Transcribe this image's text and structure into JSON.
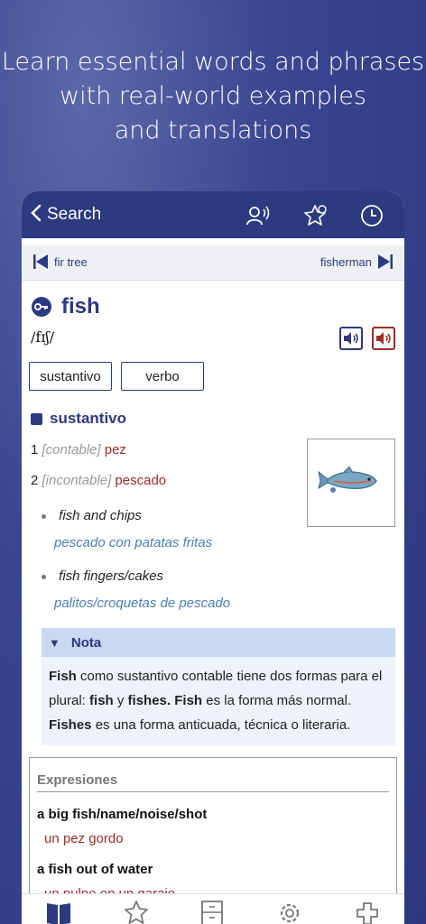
{
  "promo": {
    "line1": "Learn essential words and phrases",
    "line2": "with real-world examples",
    "line3": "and translations"
  },
  "topbar": {
    "back_label": "Search"
  },
  "nav": {
    "prev": "fir tree",
    "next": "fisherman"
  },
  "entry": {
    "headword": "fish",
    "pronunciation": "/fɪʃ/",
    "pos_buttons": [
      "sustantivo",
      "verbo"
    ],
    "section_title": "sustantivo",
    "senses": [
      {
        "num": "1",
        "label": "[contable]",
        "translation": "pez"
      },
      {
        "num": "2",
        "label": "[incontable]",
        "translation": "pescado"
      }
    ],
    "examples": [
      {
        "en": "fish and chips",
        "es": "pescado con patatas fritas"
      },
      {
        "en": "fish fingers/cakes",
        "es": "palitos/croquetas de pescado"
      }
    ]
  },
  "nota": {
    "title": "Nota",
    "w1": "Fish",
    "t1": " como sustantivo contable tiene dos formas para el plural: ",
    "w2": "fish",
    "t2": " y ",
    "w3": "fishes.",
    "t3": " ",
    "w4": "Fish",
    "t4": " es la forma más normal. ",
    "w5": "Fishes",
    "t5": " es una forma anticuada, técnica o literaria."
  },
  "expresiones": {
    "title": "Expresiones",
    "items": [
      {
        "en": "a big fish/name/noise/shot",
        "es": "un pez gordo"
      },
      {
        "en": "a fish out of water",
        "es": "un pulpo en un garaje"
      }
    ]
  },
  "colors": {
    "primary": "#2c3a7f",
    "translation": "#9c2b25",
    "example": "#4a7fb5"
  },
  "icons": {
    "tabs": [
      "dictionary-book-icon",
      "favorites-star-icon",
      "cabinet-icon",
      "settings-gear-icon",
      "puzzle-icon"
    ]
  }
}
